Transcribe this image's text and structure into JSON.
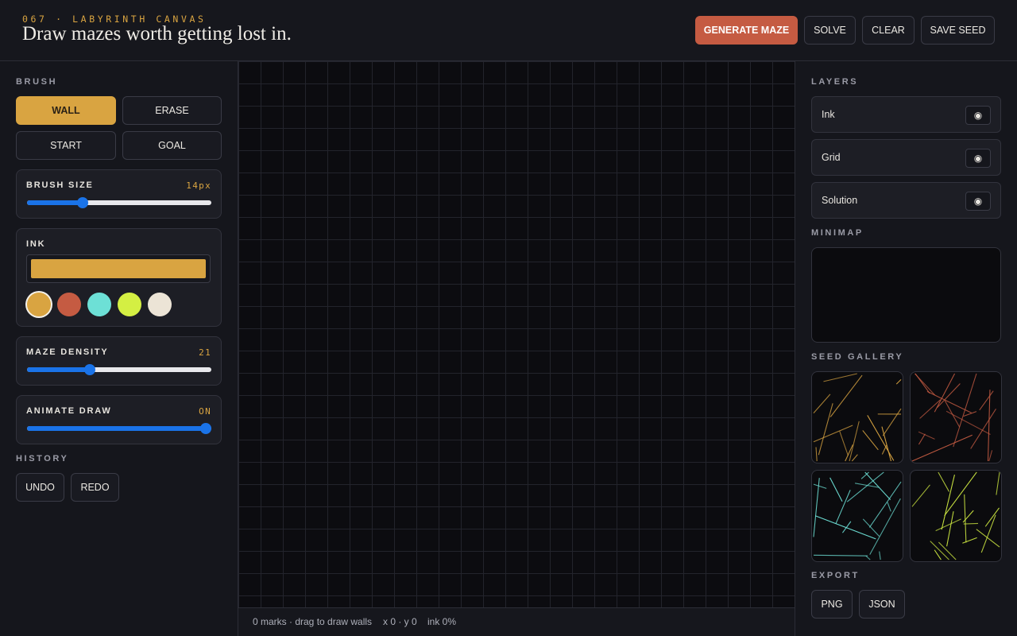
{
  "header": {
    "eyebrow": "067 · LABYRINTH CANVAS",
    "title": "Draw mazes worth getting lost in.",
    "buttons": {
      "generate": "GENERATE MAZE",
      "solve": "SOLVE",
      "clear": "CLEAR",
      "save_seed": "SAVE SEED"
    }
  },
  "brush": {
    "label": "BRUSH",
    "tools": {
      "wall": "WALL",
      "erase": "ERASE",
      "start": "START",
      "goal": "GOAL"
    },
    "active_tool": "WALL",
    "size": {
      "label": "BRUSH SIZE",
      "value": "14px",
      "fraction": 0.3
    }
  },
  "ink": {
    "label": "INK",
    "current": "#d9a441",
    "swatches": [
      "#d9a441",
      "#c55b42",
      "#6de0d6",
      "#d4ef43",
      "#ece4d6"
    ],
    "active_swatch": 0
  },
  "density": {
    "label": "MAZE DENSITY",
    "value": "21",
    "fraction": 0.34
  },
  "animate": {
    "label": "ANIMATE DRAW",
    "value": "ON",
    "fraction": 0.97
  },
  "history": {
    "label": "HISTORY",
    "undo": "UNDO",
    "redo": "REDO"
  },
  "status": {
    "marks": "0 marks · drag to draw walls",
    "coords": "x 0 · y 0",
    "ink": "ink 0%"
  },
  "layers": {
    "label": "LAYERS",
    "items": [
      {
        "name": "Ink",
        "icon": "eye-icon",
        "glyph": "◉"
      },
      {
        "name": "Grid",
        "icon": "eye-icon",
        "glyph": "◉"
      },
      {
        "name": "Solution",
        "icon": "eye-icon",
        "glyph": "◉"
      }
    ]
  },
  "minimap": {
    "label": "MINIMAP"
  },
  "gallery": {
    "label": "SEED GALLERY",
    "colors": [
      "#d9a441",
      "#c55b42",
      "#6de0d6",
      "#d4ef43"
    ]
  },
  "export": {
    "label": "EXPORT",
    "png": "PNG",
    "json": "JSON"
  },
  "colors": {
    "accent": "#d9a441",
    "primary": "#c55b42",
    "slider": "#1a73e8",
    "background": "#15161c"
  }
}
